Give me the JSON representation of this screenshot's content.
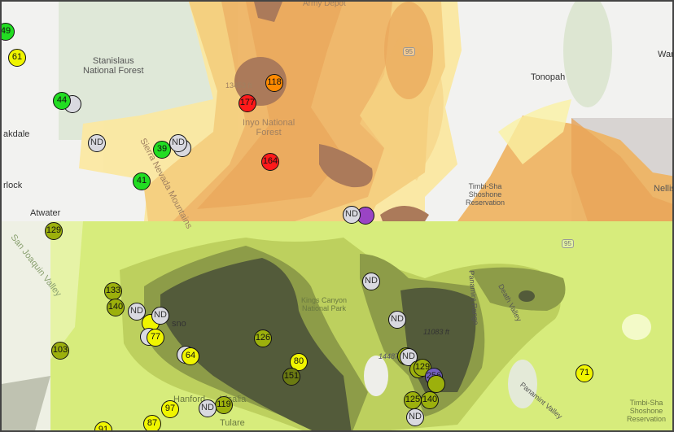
{
  "map": {
    "place_labels": {
      "stanislaus": "Stanislaus\nNational Forest",
      "inyo": "Inyo National\nForest",
      "sierra": "Sierra Nevada Mountains",
      "oakdale": "akdale",
      "turlock": "rlock",
      "atwater": "Atwater",
      "san_joaquin": "San Joaquin Valley",
      "tonopah": "Tonopah",
      "war": "War",
      "nellis": "Nellis",
      "timbisha_north": "Timbi-Sha\nShoshone\nReservation",
      "timbisha_south": "Timbi-Sha\nShoshone\nReservation",
      "kings_canyon": "Kings Canyon\nNational Park",
      "fresno": "sno",
      "hanford": "Hanford",
      "visalia": "Visalia",
      "tulare": "Tulare",
      "death_valley": "Death Valley",
      "panamint_range": "Panamint Range",
      "panamint_valley": "Panamint Valley",
      "elev_13453": "13453 ft",
      "elev_11083": "11083 ft",
      "elev_14487": "14487",
      "army_depot": "Army Depot",
      "hw95_a": "95",
      "hw95_b": "95"
    },
    "colors": {
      "good": "#22dd22",
      "moderate": "#f0f500",
      "usg": "#ff8a00",
      "unhealthy": "#ff1a1a",
      "very_unhealthy": "#9a44c4",
      "very_unhealthy_2": "#7461c0",
      "nd": "#d9d9e0",
      "olive": "#9cb00c",
      "dark_olive": "#6b7a12"
    },
    "markers": [
      {
        "label": "49",
        "cat": "good"
      },
      {
        "label": "61",
        "cat": "moderate"
      },
      {
        "label": "",
        "cat": "nd"
      },
      {
        "label": "44",
        "cat": "good"
      },
      {
        "label": "ND",
        "cat": "nd"
      },
      {
        "label": "",
        "cat": "nd"
      },
      {
        "label": "ND",
        "cat": "nd"
      },
      {
        "label": "39",
        "cat": "good"
      },
      {
        "label": "41",
        "cat": "good"
      },
      {
        "label": "118",
        "cat": "usg"
      },
      {
        "label": "177",
        "cat": "unhealthy"
      },
      {
        "label": "164",
        "cat": "unhealthy"
      },
      {
        "label": "",
        "cat": "very_unhealthy"
      },
      {
        "label": "ND",
        "cat": "nd"
      },
      {
        "label": "129",
        "cat": "olive"
      },
      {
        "label": "133",
        "cat": "olive"
      },
      {
        "label": "140",
        "cat": "olive"
      },
      {
        "label": "ND",
        "cat": "nd"
      },
      {
        "label": "",
        "cat": "moderate"
      },
      {
        "label": "ND",
        "cat": "nd"
      },
      {
        "label": "",
        "cat": "nd"
      },
      {
        "label": "77",
        "cat": "moderate"
      },
      {
        "label": "103",
        "cat": "olive"
      },
      {
        "label": "",
        "cat": "nd"
      },
      {
        "label": "64",
        "cat": "moderate"
      },
      {
        "label": "126",
        "cat": "olive"
      },
      {
        "label": "80",
        "cat": "moderate"
      },
      {
        "label": "151",
        "cat": "dark_olive"
      },
      {
        "label": "97",
        "cat": "moderate"
      },
      {
        "label": "87",
        "cat": "moderate"
      },
      {
        "label": "91",
        "cat": "moderate"
      },
      {
        "label": "119",
        "cat": "olive"
      },
      {
        "label": "ND",
        "cat": "nd"
      },
      {
        "label": "ND",
        "cat": "nd"
      },
      {
        "label": "ND",
        "cat": "nd"
      },
      {
        "label": "",
        "cat": "olive"
      },
      {
        "label": "ND",
        "cat": "nd"
      },
      {
        "label": "",
        "cat": "olive"
      },
      {
        "label": "129",
        "cat": "olive"
      },
      {
        "label": "256",
        "cat": "very_unhealthy_2"
      },
      {
        "label": "",
        "cat": "olive"
      },
      {
        "label": "125",
        "cat": "olive"
      },
      {
        "label": "140",
        "cat": "olive"
      },
      {
        "label": "ND",
        "cat": "nd"
      },
      {
        "label": "71",
        "cat": "moderate"
      }
    ]
  }
}
